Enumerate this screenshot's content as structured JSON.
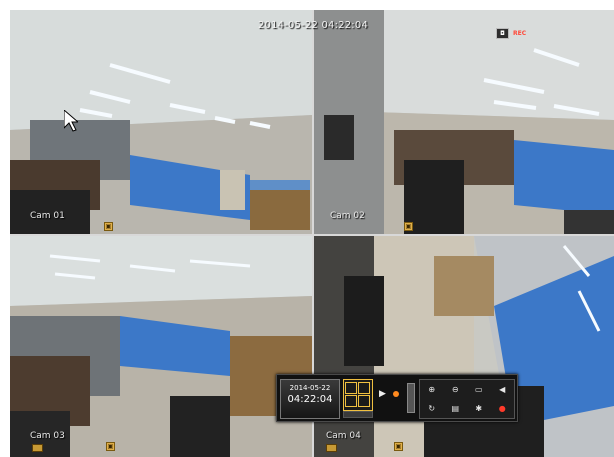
{
  "osd": {
    "datetime": "2014-05-22 04:22:04",
    "status_icons": [
      "camera-icon",
      "rec-icon"
    ],
    "rec_label": "REC"
  },
  "cameras": [
    {
      "label": "Cam 01"
    },
    {
      "label": "Cam 02"
    },
    {
      "label": "Cam 03"
    },
    {
      "label": "Cam 04"
    }
  ],
  "control_bar": {
    "date": "2014-05-22",
    "time": "04:22:04",
    "layout": "quad",
    "tools": [
      "zoom-in-icon",
      "zoom-out-icon",
      "fullscreen-icon",
      "volume-icon",
      "refresh-icon",
      "print-icon",
      "ptz-icon",
      "record-icon"
    ]
  },
  "colors": {
    "partition_blue": "#3c78c8",
    "ceiling": "#d9dde0",
    "floor": "#cfc8b6",
    "accent": "#f0c040"
  }
}
